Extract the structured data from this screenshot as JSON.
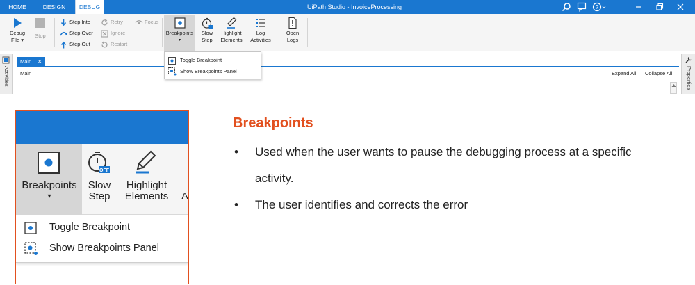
{
  "titlebar": {
    "tabs": [
      {
        "label": "HOME",
        "active": false
      },
      {
        "label": "DESIGN",
        "active": false
      },
      {
        "label": "DEBUG",
        "active": true
      }
    ],
    "app_title": "UiPath Studio - InvoiceProcessing"
  },
  "ribbon": {
    "debug_label": "Debug",
    "debug_sub": "File ▾",
    "stop_label": "Stop",
    "step_into": "Step Into",
    "step_over": "Step Over",
    "step_out": "Step Out",
    "retry": "Retry",
    "ignore": "Ignore",
    "restart": "Restart",
    "focus": "Focus",
    "breakpoints": "Breakpoints",
    "slow_step_1": "Slow",
    "slow_step_2": "Step",
    "highlight_1": "Highlight",
    "highlight_2": "Elements",
    "log_1": "Log",
    "log_2": "Activities",
    "open_logs_1": "Open",
    "open_logs_2": "Logs"
  },
  "breakpoints_menu": {
    "toggle": "Toggle Breakpoint",
    "show_panel": "Show Breakpoints Panel"
  },
  "workspace": {
    "left_panel": "Activities",
    "right_panel": "Properties",
    "doc_tab": "Main",
    "breadcrumb": "Main",
    "expand_all": "Expand All",
    "collapse_all": "Collapse All"
  },
  "zoom": {
    "breakpoints": "Breakpoints",
    "slow_step_1": "Slow",
    "slow_step_2": "Step",
    "highlight_1": "Highlight",
    "highlight_2": "Elements",
    "partial": "A",
    "off_badge": "OFF",
    "toggle": "Toggle Breakpoint",
    "show_panel": "Show Breakpoints Panel"
  },
  "explanation": {
    "heading": "Breakpoints",
    "bullet_char": "•",
    "bullets": [
      "Used when the user wants to pause the debugging process at a specific activity.",
      "The user identifies and corrects the error"
    ]
  },
  "colors": {
    "accent_blue": "#1a77d0",
    "heading_orange": "#e2501f"
  }
}
